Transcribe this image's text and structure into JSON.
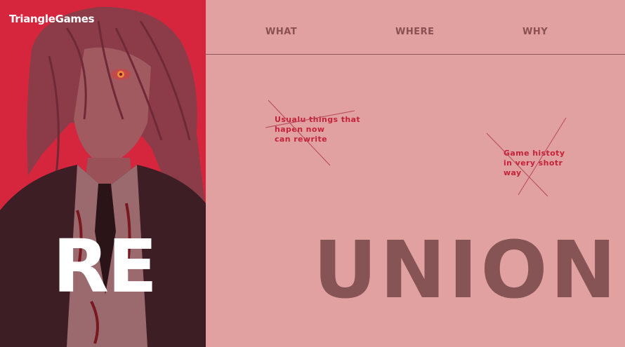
{
  "brand": {
    "name": "TriangleGames"
  },
  "hero": {
    "title_left": "RE",
    "title_right": "UNION"
  },
  "nav": {
    "items": [
      {
        "label": "WHAT"
      },
      {
        "label": "WHERE"
      },
      {
        "label": "WHY"
      }
    ]
  },
  "notes": [
    {
      "lines": [
        "Usualu things that",
        "hapen now",
        "can rewrite"
      ]
    },
    {
      "lines": [
        "Game histoty",
        "in very shotr",
        "way"
      ]
    }
  ],
  "colors": {
    "panel_red": "#d5263e",
    "page_pink": "#e0a1a0",
    "title_brown": "#865455",
    "note_red": "#c4223a",
    "nav_brown": "#8a5052"
  }
}
